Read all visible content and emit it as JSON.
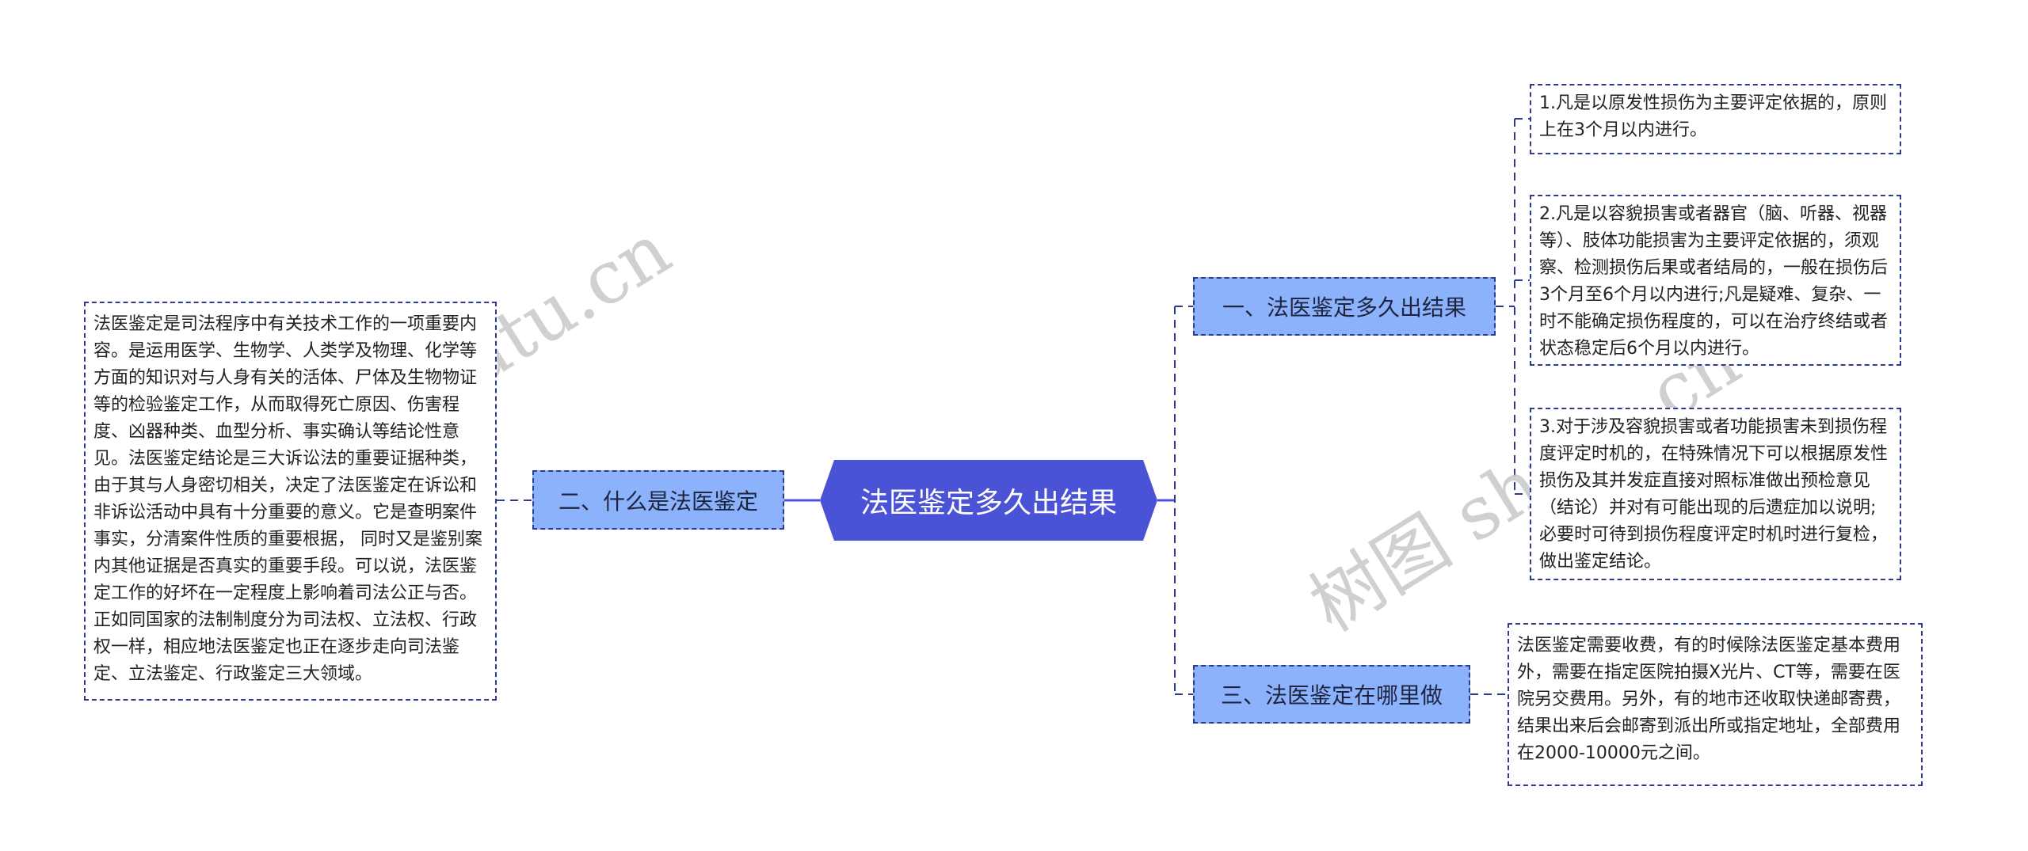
{
  "mindmap": {
    "root": {
      "label": "法医鉴定多久出结果"
    },
    "branches": [
      {
        "label": "一、法医鉴定多久出结果",
        "side": "right",
        "children": [
          "1.凡是以原发性损伤为主要评定依据的，原则上在3个月以内进行。",
          "2.凡是以容貌损害或者器官（脑、听器、视器等）、肢体功能损害为主要评定依据的，须观察、检测损伤后果或者结局的，一般在损伤后3个月至6个月以内进行;凡是疑难、复杂、一时不能确定损伤程度的，可以在治疗终结或者状态稳定后6个月以内进行。",
          "3.对于涉及容貌损害或者功能损害未到损伤程度评定时机的，在特殊情况下可以根据原发性损伤及其并发症直接对照标准做出预检意见（结论）并对有可能出现的后遗症加以说明;必要时可待到损伤程度评定时机时进行复检，做出鉴定结论。"
        ]
      },
      {
        "label": "二、什么是法医鉴定",
        "side": "left",
        "children": [
          "法医鉴定是司法程序中有关技术工作的一项重要内容。是运用医学、生物学、人类学及物理、化学等方面的知识对与人身有关的活体、尸体及生物物证等的检验鉴定工作，从而取得死亡原因、伤害程度、凶器种类、血型分析、事实确认等结论性意见。法医鉴定结论是三大诉讼法的重要证据种类，由于其与人身密切相关，决定了法医鉴定在诉讼和非诉讼活动中具有十分重要的意义。它是查明案件事实，分清案件性质的重要根据， 同时又是鉴别案内其他证据是否真实的重要手段。可以说，法医鉴定工作的好坏在一定程度上影响着司法公正与否。正如同国家的法制制度分为司法权、立法权、行政权一样，相应地法医鉴定也正在逐步走向司法鉴定、立法鉴定、行政鉴定三大领域。"
        ]
      },
      {
        "label": "三、法医鉴定在哪里做",
        "side": "right",
        "children": [
          "法医鉴定需要收费，有的时候除法医鉴定基本费用外，需要在指定医院拍摄X光片、CT等，需要在医院另交费用。另外，有的地市还收取快递邮寄费，结果出来后会邮寄到派出所或指定地址，全部费用在2000-10000元之间。"
        ]
      }
    ]
  },
  "watermarks": [
    "树图 shutu.cn",
    "树图 shutu.cn"
  ],
  "colors": {
    "root_fill": "#4a52d6",
    "branch_fill": "#8bb2fb",
    "line": "#2e3a8c",
    "watermark": "#c8c8c8"
  }
}
